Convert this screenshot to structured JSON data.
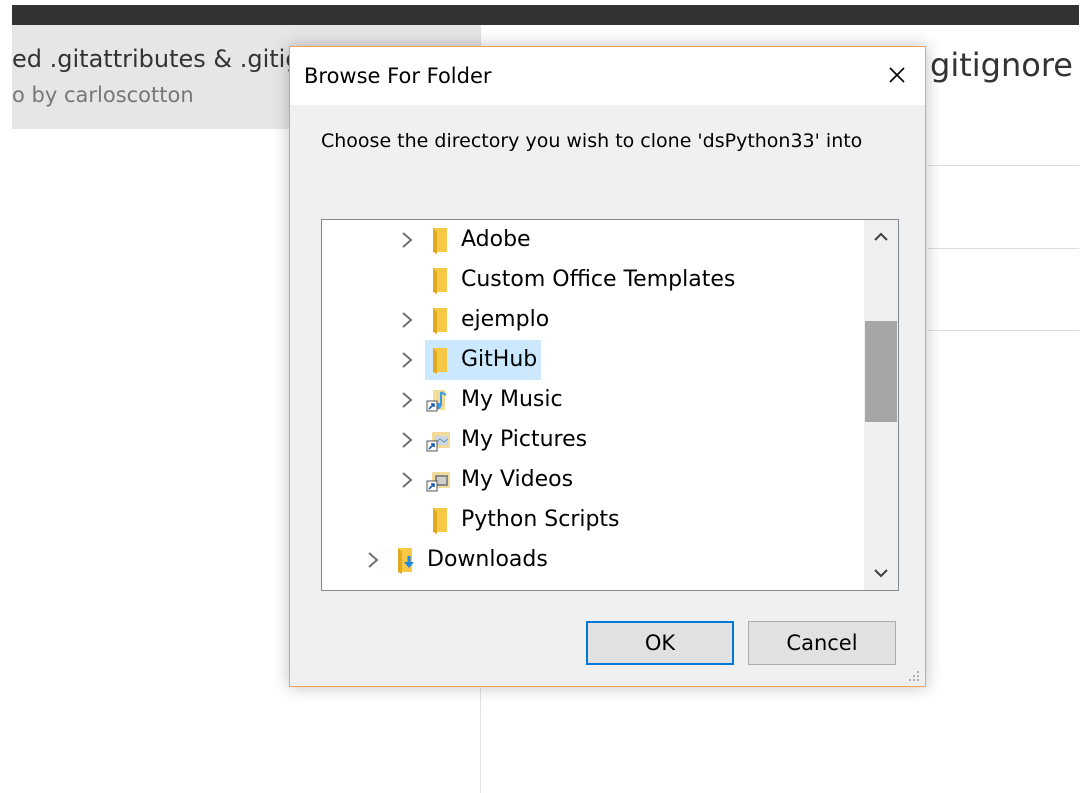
{
  "background": {
    "left_title": "ed .gitattributes & .gitig",
    "left_subtitle": "o by carloscotton",
    "right_title": "gitignore"
  },
  "dialog": {
    "title": "Browse For Folder",
    "prompt": "Choose the directory you wish to clone 'dsPython33' into",
    "tree_items": [
      {
        "label": "Adobe",
        "icon": "folder-icon",
        "expandable": true,
        "selected": false
      },
      {
        "label": "Custom Office Templates",
        "icon": "folder-icon",
        "expandable": false,
        "selected": false
      },
      {
        "label": "ejemplo",
        "icon": "folder-icon",
        "expandable": true,
        "selected": false
      },
      {
        "label": "GitHub",
        "icon": "folder-icon",
        "expandable": true,
        "selected": true
      },
      {
        "label": "My Music",
        "icon": "music-shortcut-icon",
        "expandable": true,
        "selected": false
      },
      {
        "label": "My Pictures",
        "icon": "pictures-shortcut-icon",
        "expandable": true,
        "selected": false
      },
      {
        "label": "My Videos",
        "icon": "videos-shortcut-icon",
        "expandable": true,
        "selected": false
      },
      {
        "label": "Python Scripts",
        "icon": "folder-icon",
        "expandable": false,
        "selected": false
      },
      {
        "label": "Downloads",
        "icon": "downloads-folder-icon",
        "expandable": true,
        "selected": false
      }
    ],
    "ok_label": "OK",
    "cancel_label": "Cancel"
  },
  "colors": {
    "dialog_border": "#f0a250",
    "selection": "#cce8ff",
    "ok_border": "#0078d7",
    "folder": "#f6c846"
  }
}
